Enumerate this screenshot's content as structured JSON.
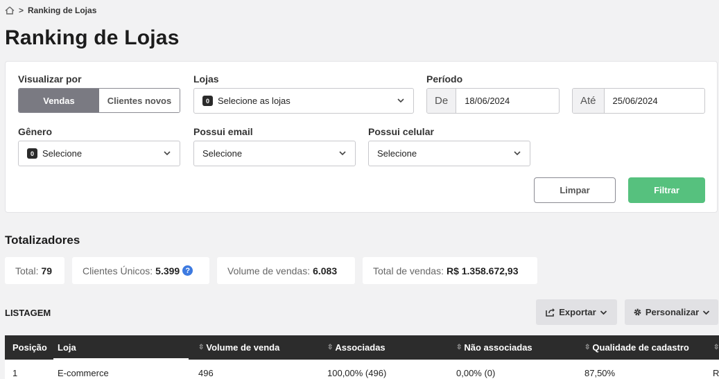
{
  "breadcrumb": {
    "current": "Ranking de Lojas",
    "separator": ">"
  },
  "page_title": "Ranking de Lojas",
  "filters": {
    "visualizar_por": {
      "label": "Visualizar por",
      "options": [
        "Vendas",
        "Clientes novos"
      ],
      "selected": "Vendas"
    },
    "lojas": {
      "label": "Lojas",
      "badge": "0",
      "placeholder": "Selecione as lojas"
    },
    "periodo": {
      "label": "Período",
      "de_label": "De",
      "de_value": "18/06/2024",
      "ate_label": "Até",
      "ate_value": "25/06/2024"
    },
    "genero": {
      "label": "Gênero",
      "badge": "0",
      "placeholder": "Selecione"
    },
    "possui_email": {
      "label": "Possui email",
      "placeholder": "Selecione"
    },
    "possui_celular": {
      "label": "Possui celular",
      "placeholder": "Selecione"
    },
    "limpar_label": "Limpar",
    "filtrar_label": "Filtrar"
  },
  "totalizadores": {
    "title": "Totalizadores",
    "total_label": "Total:",
    "total_value": "79",
    "clientes_label": "Clientes Únicos:",
    "clientes_value": "5.399",
    "volume_label": "Volume de vendas:",
    "volume_value": "6.083",
    "total_vendas_label": "Total de vendas:",
    "total_vendas_value": "R$ 1.358.672,93"
  },
  "listagem": {
    "title": "LISTAGEM",
    "exportar_label": "Exportar",
    "personalizar_label": "Personalizar"
  },
  "table": {
    "columns": [
      "Posição",
      "Loja",
      "Volume de venda",
      "Associadas",
      "Não associadas",
      "Qualidade de cadastro"
    ],
    "rows": [
      {
        "posicao": "1",
        "loja": "E-commerce",
        "volume": "496",
        "associadas": "100,00% (496)",
        "nao_associadas": "0,00% (0)",
        "qualidade": "87,50%",
        "extra": "R"
      }
    ]
  },
  "colors": {
    "accent_green": "#56c17e",
    "header_dark": "#2c2c2c",
    "segment_active": "#7a7a82",
    "help_blue": "#3d7ae0"
  }
}
